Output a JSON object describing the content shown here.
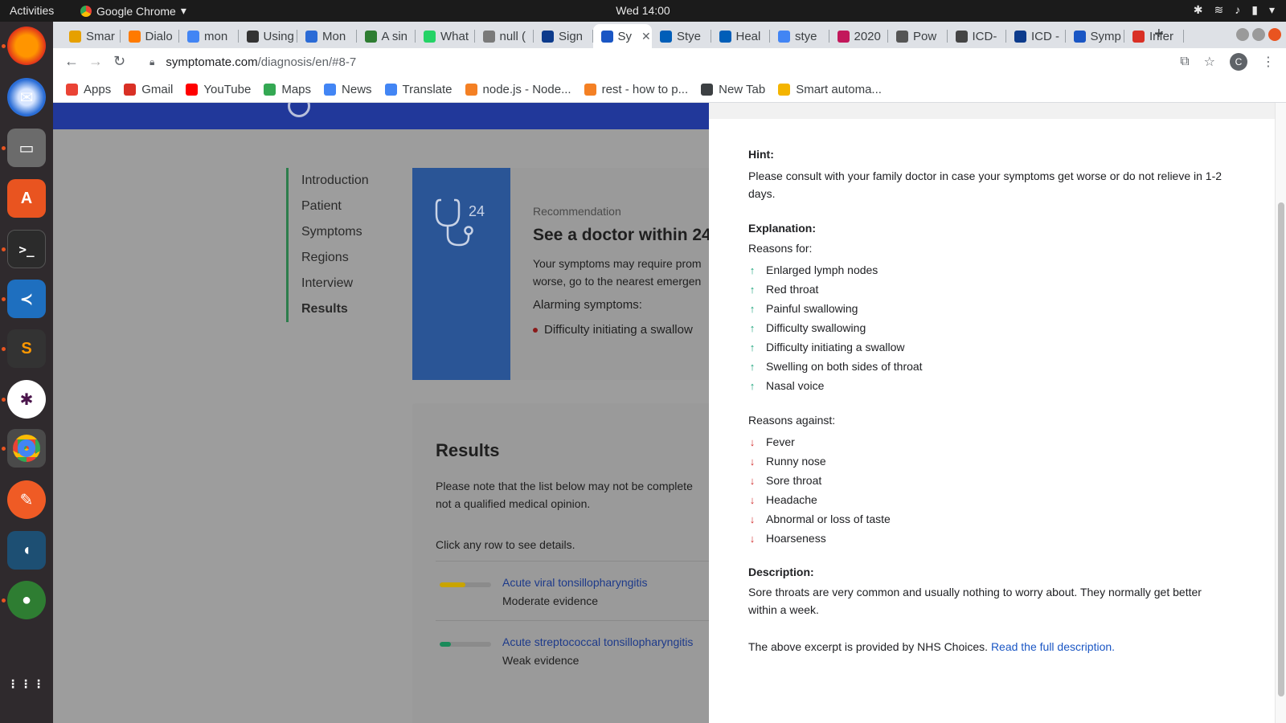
{
  "system": {
    "activities": "Activities",
    "app_name": "Google Chrome",
    "clock": "Wed 14:00"
  },
  "browser": {
    "tabs": [
      {
        "label": "Smar",
        "color": "#e6a000"
      },
      {
        "label": "Dialo",
        "color": "#ff7a00"
      },
      {
        "label": "mon",
        "color": "#4285f4"
      },
      {
        "label": "Using",
        "color": "#333333"
      },
      {
        "label": "Mon",
        "color": "#2b6bd6"
      },
      {
        "label": "A sin",
        "color": "#2e7d32"
      },
      {
        "label": "What",
        "color": "#25d366"
      },
      {
        "label": "null (",
        "color": "#7a7a7a"
      },
      {
        "label": "Sign",
        "color": "#0d3b8c"
      },
      {
        "label": "Sy",
        "color": "#1a56c4"
      },
      {
        "label": "Stye",
        "color": "#005eb8"
      },
      {
        "label": "Heal",
        "color": "#005eb8"
      },
      {
        "label": "stye",
        "color": "#4285f4"
      },
      {
        "label": "2020",
        "color": "#c2185b"
      },
      {
        "label": "Pow",
        "color": "#555555"
      },
      {
        "label": "ICD-",
        "color": "#444444"
      },
      {
        "label": "ICD -",
        "color": "#0d3b8c"
      },
      {
        "label": "Symp",
        "color": "#1a56c4"
      },
      {
        "label": "Infer",
        "color": "#d93025"
      }
    ],
    "active_tab_index": 9,
    "url_host": "symptomate.com",
    "url_path": "/diagnosis/en/#8-7",
    "profile_initial": "C",
    "bookmarks": [
      {
        "label": "Apps",
        "color": "#ea4335"
      },
      {
        "label": "Gmail",
        "color": "#d93025"
      },
      {
        "label": "YouTube",
        "color": "#ff0000"
      },
      {
        "label": "Maps",
        "color": "#34a853"
      },
      {
        "label": "News",
        "color": "#4285f4"
      },
      {
        "label": "Translate",
        "color": "#4285f4"
      },
      {
        "label": "node.js - Node...",
        "color": "#f48024"
      },
      {
        "label": "rest - how to p...",
        "color": "#f48024"
      },
      {
        "label": "New Tab",
        "color": "#3c4043"
      },
      {
        "label": "Smart automa...",
        "color": "#f4b400"
      }
    ]
  },
  "site": {
    "nav": [
      "Introduction",
      "Patient",
      "Symptoms",
      "Regions",
      "Interview",
      "Results"
    ],
    "active_nav": "Results",
    "recommendation": {
      "hours": "24",
      "label": "Recommendation",
      "title": "See a doctor within 24",
      "text_line1": "Your symptoms may require prom",
      "text_line2": "worse, go to the nearest emergen",
      "alarming_label": "Alarming symptoms:",
      "alarming_items": [
        "Difficulty initiating a swallow"
      ]
    },
    "results": {
      "title": "Results",
      "note_line1": "Please note that the list below may not be complete",
      "note_line2": "not a qualified medical opinion.",
      "click_hint": "Click any row to see details.",
      "rows": [
        {
          "name": "Acute viral tonsillopharyngitis",
          "evidence": "Moderate evidence",
          "level": 0.5,
          "color": "#c9a400"
        },
        {
          "name": "Acute streptococcal tonsillopharyngitis",
          "evidence": "Weak evidence",
          "level": 0.22,
          "color": "#1a8a5a"
        }
      ]
    }
  },
  "panel": {
    "hint_title": "Hint:",
    "hint_text": "Please consult with your family doctor in case your symptoms get worse or do not relieve in 1-2 days.",
    "explanation_title": "Explanation:",
    "reasons_for_label": "Reasons for:",
    "reasons_for": [
      "Enlarged lymph nodes",
      "Red throat",
      "Painful swallowing",
      "Difficulty swallowing",
      "Difficulty initiating a swallow",
      "Swelling on both sides of throat",
      "Nasal voice"
    ],
    "reasons_against_label": "Reasons against:",
    "reasons_against": [
      "Fever",
      "Runny nose",
      "Sore throat",
      "Headache",
      "Abnormal or loss of taste",
      "Hoarseness"
    ],
    "description_title": "Description:",
    "description_text": "Sore throats are very common and usually nothing to worry about. They normally get better within a week.",
    "excerpt_text": "The above excerpt is provided by NHS Choices.",
    "read_more": "Read the full description."
  }
}
